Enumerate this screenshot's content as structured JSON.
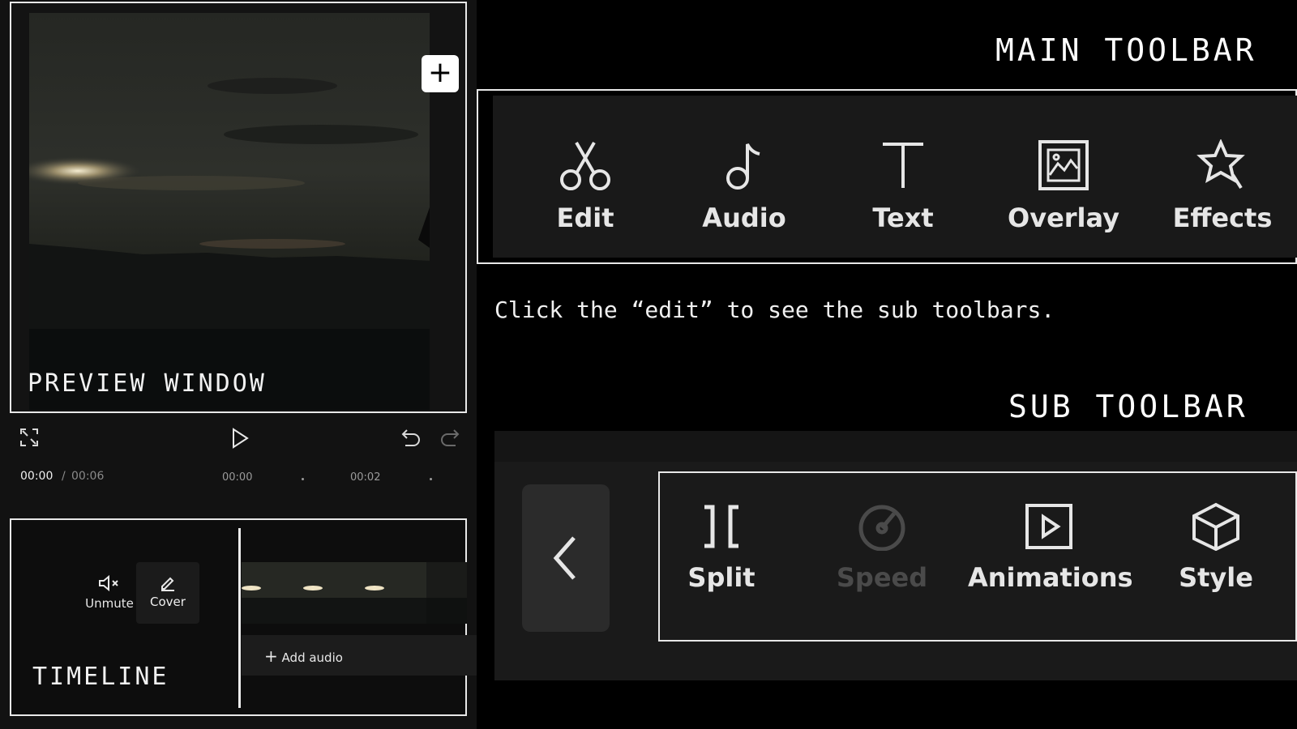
{
  "labels": {
    "preview_window": "PREVIEW WINDOW",
    "timeline": "TIMELINE",
    "main_toolbar": "MAIN TOOLBAR",
    "sub_toolbar": "SUB TOOLBAR",
    "hint": "Click the “edit” to see the sub toolbars."
  },
  "playback": {
    "current_time": "00:00",
    "separator": "/",
    "total_time": "00:06",
    "ticks": [
      "00:00",
      "00:02"
    ]
  },
  "timeline": {
    "unmute_label": "Unmute",
    "cover_label": "Cover",
    "add_clip_label": "+",
    "add_audio_label": "Add audio"
  },
  "main_toolbar": {
    "items": [
      {
        "label": "Edit",
        "icon": "scissors-icon"
      },
      {
        "label": "Audio",
        "icon": "music-note-icon"
      },
      {
        "label": "Text",
        "icon": "text-icon"
      },
      {
        "label": "Overlay",
        "icon": "image-icon"
      },
      {
        "label": "Effects",
        "icon": "star-wand-icon"
      }
    ]
  },
  "sub_toolbar": {
    "items": [
      {
        "label": "Split",
        "icon": "split-icon",
        "enabled": true
      },
      {
        "label": "Speed",
        "icon": "speedometer-icon",
        "enabled": false
      },
      {
        "label": "Animations",
        "icon": "play-frame-icon",
        "enabled": true
      },
      {
        "label": "Style",
        "icon": "cube-icon",
        "enabled": true
      }
    ]
  },
  "colors": {
    "background": "#000000",
    "panel": "#191919",
    "outline": "#e8e8e8",
    "disabled_text": "#4a4a4a"
  }
}
